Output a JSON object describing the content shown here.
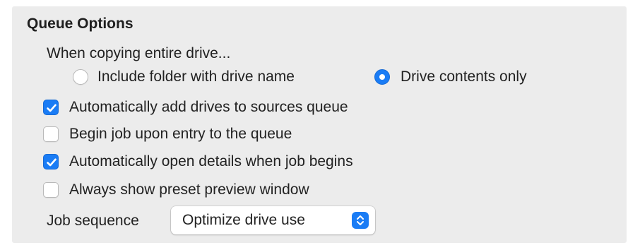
{
  "section": {
    "title": "Queue Options"
  },
  "copy_drive": {
    "label": "When copying entire drive...",
    "options": [
      {
        "label": "Include folder with drive name",
        "selected": false
      },
      {
        "label": "Drive contents only",
        "selected": true
      }
    ]
  },
  "checkboxes": [
    {
      "label": "Automatically add drives to sources queue",
      "checked": true
    },
    {
      "label": "Begin job upon entry to the queue",
      "checked": false
    },
    {
      "label": "Automatically open details when job begins",
      "checked": true
    },
    {
      "label": "Always show preset preview window",
      "checked": false
    }
  ],
  "job_sequence": {
    "label": "Job sequence",
    "selected": "Optimize drive use",
    "icon": "chevron-up-down-icon"
  },
  "colors": {
    "accent": "#1a7cf5",
    "panel_background": "#ececec"
  }
}
